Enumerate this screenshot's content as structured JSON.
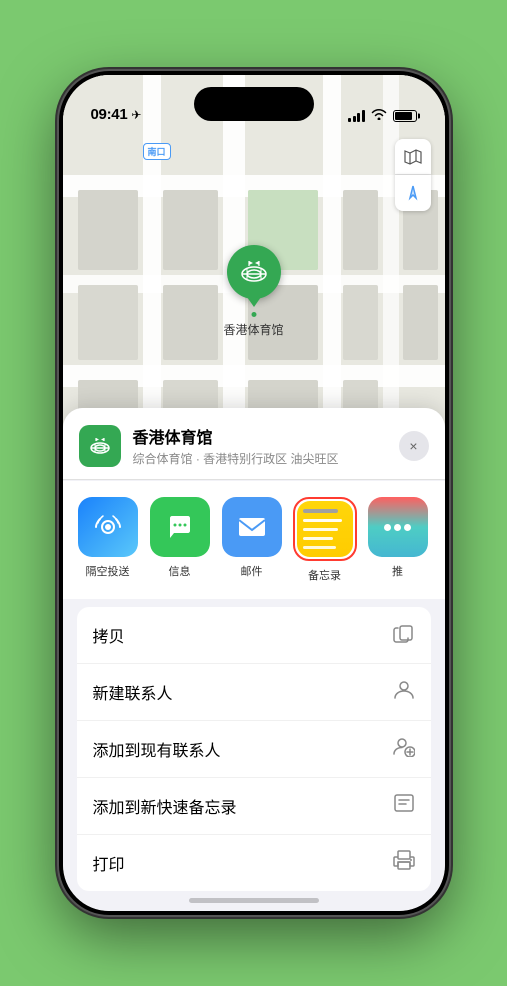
{
  "status_bar": {
    "time": "09:41",
    "location_arrow": "▶"
  },
  "map": {
    "road_label": "南口",
    "road_prefix": "南口"
  },
  "map_controls": {
    "map_type_icon": "🗺",
    "location_icon": "➤"
  },
  "pin": {
    "label": "香港体育馆"
  },
  "location_card": {
    "name": "香港体育馆",
    "subtitle": "综合体育馆 · 香港特别行政区 油尖旺区",
    "close_label": "×"
  },
  "share_items": [
    {
      "id": "airdrop",
      "label": "隔空投送",
      "type": "airdrop"
    },
    {
      "id": "messages",
      "label": "信息",
      "type": "messages"
    },
    {
      "id": "mail",
      "label": "邮件",
      "type": "mail"
    },
    {
      "id": "notes",
      "label": "备忘录",
      "type": "notes"
    },
    {
      "id": "more",
      "label": "推",
      "type": "more"
    }
  ],
  "actions": [
    {
      "id": "copy",
      "label": "拷贝",
      "icon": "copy"
    },
    {
      "id": "new-contact",
      "label": "新建联系人",
      "icon": "person"
    },
    {
      "id": "add-existing",
      "label": "添加到现有联系人",
      "icon": "person-add"
    },
    {
      "id": "add-note",
      "label": "添加到新快速备忘录",
      "icon": "note"
    },
    {
      "id": "print",
      "label": "打印",
      "icon": "printer"
    }
  ]
}
